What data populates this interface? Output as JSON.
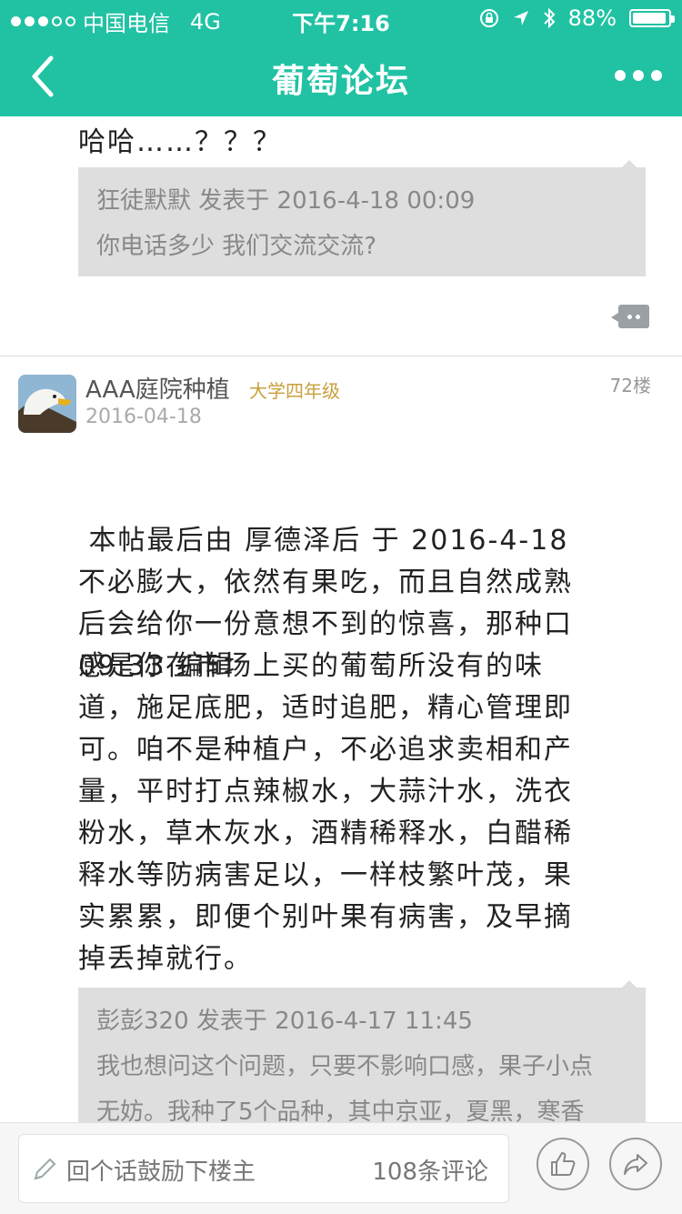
{
  "status_bar": {
    "carrier": "中国电信",
    "network": "4G",
    "time": "下午7:16",
    "battery": "88%"
  },
  "nav": {
    "title": "葡萄论坛"
  },
  "post_prev": {
    "text": "哈哈……？？？",
    "quote_meta": "狂徒默默 发表于 2016-4-18 00:09",
    "quote_text": "你电话多少 我们交流交流?"
  },
  "post": {
    "username": "AAA庭院种植",
    "rank": "大学四年级",
    "date": "2016-04-18",
    "floor": "72楼",
    "edit_line1": " 本帖最后由 厚德泽后 于 2016-4-18",
    "edit_line2": "09:33 编辑",
    "body_lines": [
      "不必膨大，依然有果吃，而且自然成熟",
      "后会给你一份意想不到的惊喜，那种口",
      "感是你在市场上买的葡萄所没有的味",
      "道，施足底肥，适时追肥，精心管理即",
      "可。咱不是种植户，不必追求卖相和产",
      "量，平时打点辣椒水，大蒜汁水，洗衣",
      "粉水，草木灰水，酒精稀释水，白醋稀",
      "释水等防病害足以，一样枝繁叶茂，果",
      "实累累，即便个别叶果有病害，及早摘",
      "掉丢掉就行。"
    ],
    "quote_meta": "彭彭320 发表于 2016-4-17 11:45",
    "quote_lines": [
      "我也想问这个问题，只要不影响口感，果子小点",
      "无妨。我种了5个品种，其中京亚，夏黑，寒香"
    ]
  },
  "bottom_bar": {
    "placeholder": "回个话鼓励下楼主",
    "comment_count": "108条评论"
  },
  "colors": {
    "brand": "#20c2a3",
    "rank": "#c8a03c"
  }
}
